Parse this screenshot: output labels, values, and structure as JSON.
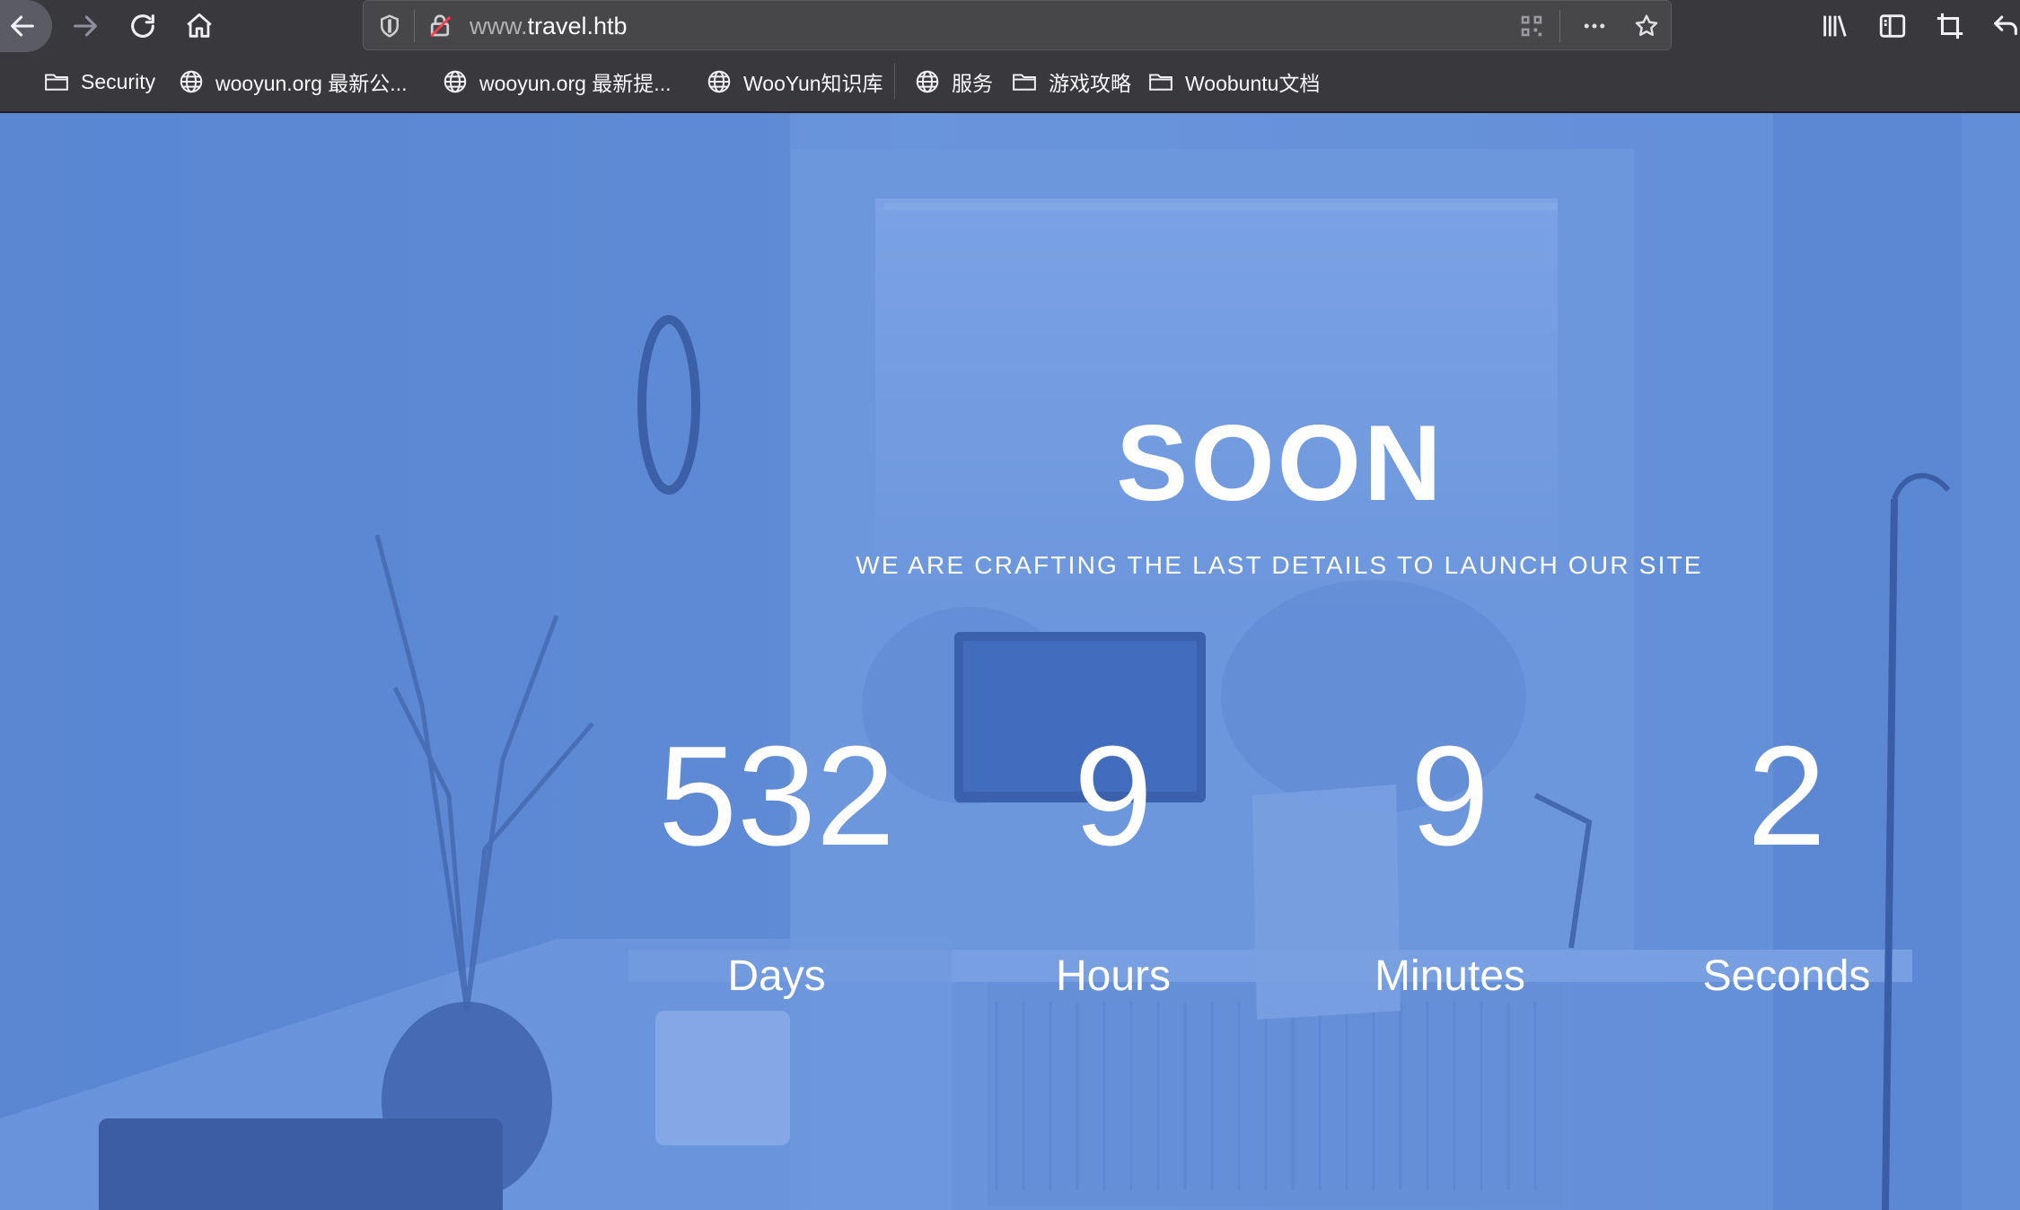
{
  "browser": {
    "url_prefix": "www.",
    "url_domain": "travel.htb",
    "icons": {
      "back": "back-arrow-icon",
      "forward": "forward-arrow-icon",
      "reload": "reload-icon",
      "home": "home-icon",
      "tracking": "shield-icon",
      "insecure": "insecure-lock-icon",
      "qr": "qr-code-icon",
      "more": "more-dots-icon",
      "bookmark": "star-icon",
      "library": "library-icon",
      "sidebar": "sidebar-icon",
      "screenshot": "crop-icon",
      "undo": "undo-icon"
    }
  },
  "bookmarks": [
    {
      "label": "Security",
      "icon": "folder-icon"
    },
    {
      "label": "wooyun.org 最新公...",
      "icon": "globe-icon"
    },
    {
      "label": "wooyun.org 最新提...",
      "icon": "globe-icon"
    },
    {
      "label": "WooYun知识库",
      "icon": "globe-icon"
    },
    {
      "label": "服务",
      "icon": "globe-icon"
    },
    {
      "label": "游戏攻略",
      "icon": "folder-icon"
    },
    {
      "label": "Woobuntu文档",
      "icon": "folder-icon"
    }
  ],
  "page": {
    "title": "SOON",
    "tagline": "WE ARE CRAFTING THE LAST DETAILS TO LAUNCH OUR SITE",
    "countdown": [
      {
        "value": "532",
        "label": "Days"
      },
      {
        "value": "9",
        "label": "Hours"
      },
      {
        "value": "9",
        "label": "Minutes"
      },
      {
        "value": "2",
        "label": "Seconds"
      }
    ],
    "overlay_color": "#5b87d6"
  }
}
